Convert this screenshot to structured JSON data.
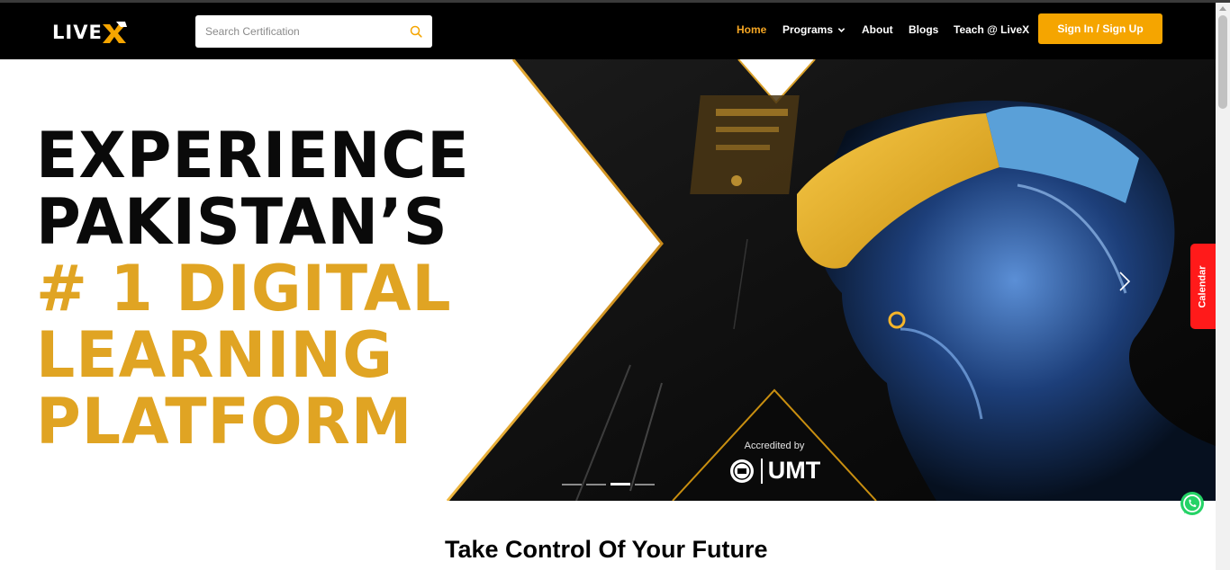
{
  "header": {
    "logo_text": "LIVE",
    "logo_mark": "X",
    "search_placeholder": "Search Certification",
    "nav": {
      "home": "Home",
      "programs": "Programs",
      "about": "About",
      "blogs": "Blogs",
      "teach": "Teach @ LiveX"
    },
    "signin_label": "Sign In / Sign Up"
  },
  "hero": {
    "line1": "EXPERIENCE",
    "line2": "PAKISTAN’S",
    "line3": "# 1 DIGITAL",
    "line4": "LEARNING",
    "line5": "PLATFORM",
    "accredited_label": "Accredited by",
    "accredited_org": "UMT",
    "slide_count": 4,
    "active_slide": 3
  },
  "calendar_label": "Calendar",
  "section": {
    "title": "Take Control Of Your Future"
  },
  "colors": {
    "accent": "#f5a500",
    "header_bg": "#000000",
    "headline_gold": "#e0a423",
    "calendar_red": "#ff1a1a",
    "whatsapp_green": "#25d366"
  },
  "icons": [
    "search-icon",
    "chevron-down-icon",
    "chevron-right-icon",
    "whatsapp-icon",
    "umt-seal-icon",
    "logo-mark-icon"
  ]
}
